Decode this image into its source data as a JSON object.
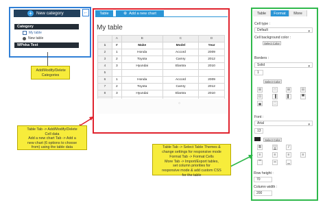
{
  "sidebar": {
    "new_category": "New category",
    "collapse": "←",
    "category": "Category",
    "my_table": "My table",
    "new_table": "New table",
    "wpeka_test": "WPeka Test",
    "note": "Add/Modify/Delete Categories"
  },
  "middle": {
    "tab_table": "Table",
    "tab_add_chart": "Add a new chart",
    "title": "My table",
    "columns": [
      "A",
      "B",
      "C",
      "D"
    ],
    "rows": [
      {
        "n": "1",
        "cells": [
          "#",
          "Make",
          "Model",
          "Year"
        ]
      },
      {
        "n": "2",
        "cells": [
          "1",
          "Honda",
          "Accord",
          "2009"
        ]
      },
      {
        "n": "3",
        "cells": [
          "2",
          "Toyota",
          "Camry",
          "2012"
        ]
      },
      {
        "n": "4",
        "cells": [
          "3",
          "Hyundai",
          "Elantra",
          "2010"
        ]
      },
      {
        "n": "5",
        "cells": [
          "",
          "",
          "",
          ""
        ]
      },
      {
        "n": "6",
        "cells": [
          "1",
          "Honda",
          "Accord",
          "2009"
        ]
      },
      {
        "n": "7",
        "cells": [
          "2",
          "Toyota",
          "Camry",
          "2012"
        ]
      },
      {
        "n": "8",
        "cells": [
          "3",
          "Hyundai",
          "Elantra",
          "2010"
        ]
      },
      {
        "n": "9",
        "cells": [
          "",
          "",
          "",
          ""
        ]
      },
      {
        "n": "10",
        "cells": [
          "2",
          "Toyota",
          "Camry",
          "2012"
        ]
      }
    ],
    "note1_line1": "Table Tab -> Add/Modify/Delete",
    "note1_line2": "Cell data",
    "note1_line3": "Add a new chart Tab -> Add a",
    "note1_line4": "new chart (6 options to choose",
    "note1_line5": "from) using the table data",
    "note2_line1": "Table Tab -> Select Table Themes &",
    "note2_line2": "change settings for responsive mode",
    "note2_line3": "Format Tab -> Format Cells",
    "note2_line4": "More Tab -> Import/Export tables,",
    "note2_line5": "set column priorities for",
    "note2_line6": "responsive mode & add custom CSS",
    "note2_line7": "for the table"
  },
  "right": {
    "tabs": [
      "Table",
      "Format",
      "More"
    ],
    "active_tab": "Format",
    "cell_type_label": "Cell type :",
    "cell_type_value": "Default",
    "cell_bg_label": "Cell background color :",
    "select_color": "Select Color",
    "borders_label": "Borders :",
    "border_style": "Solid",
    "border_width": "1",
    "font_label": "Font :",
    "font_family": "Arial",
    "font_size": "13",
    "row_height_label": "Row height :",
    "row_height": "70",
    "column_width_label": "Column width :",
    "column_width": "200",
    "bold": "B",
    "underline": "U",
    "italic": "I"
  },
  "colors": {
    "blue_frame": "#2f7fd6",
    "red_frame": "#e0222d",
    "green_frame": "#2db84a",
    "note_yellow": "#f7ec3b",
    "accent_tab": "#2b95d6"
  }
}
